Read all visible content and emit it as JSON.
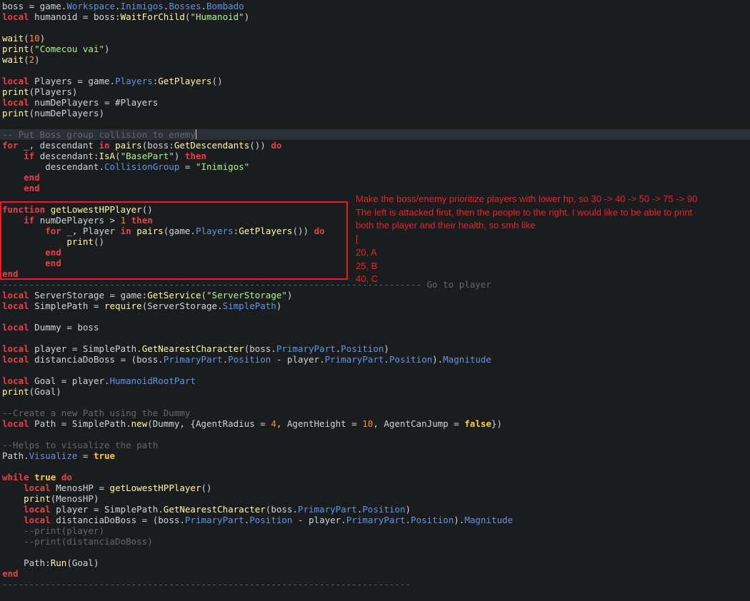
{
  "colors": {
    "background": "#1b1c1e",
    "current_line": "#2a2f38",
    "keyword": "#e6414b",
    "literal": "#fecc3d",
    "function": "#fdfaa6",
    "property": "#6195e6",
    "string": "#adf195",
    "number": "#fe8c2d",
    "comment": "#676767",
    "text": "#d4d4d4",
    "annotation": "#e8232e"
  },
  "code": [
    [
      [
        "boss = game.",
        "txt"
      ],
      [
        "Workspace",
        "prop"
      ],
      [
        ".",
        "txt"
      ],
      [
        "Inimigos",
        "prop"
      ],
      [
        ".",
        "txt"
      ],
      [
        "Bosses",
        "prop"
      ],
      [
        ".",
        "txt"
      ],
      [
        "Bombado",
        "prop"
      ]
    ],
    [
      [
        "local",
        "kw"
      ],
      [
        " humanoid = boss:",
        "txt"
      ],
      [
        "WaitForChild",
        "fn"
      ],
      [
        "(",
        "txt"
      ],
      [
        "\"Humanoid\"",
        "str"
      ],
      [
        ")",
        "txt"
      ]
    ],
    [],
    [
      [
        "wait",
        "fn"
      ],
      [
        "(",
        "txt"
      ],
      [
        "10",
        "num"
      ],
      [
        ")",
        "txt"
      ]
    ],
    [
      [
        "print",
        "fn"
      ],
      [
        "(",
        "txt"
      ],
      [
        "\"Comecou vai\"",
        "str"
      ],
      [
        ")",
        "txt"
      ]
    ],
    [
      [
        "wait",
        "fn"
      ],
      [
        "(",
        "txt"
      ],
      [
        "2",
        "num"
      ],
      [
        ")",
        "txt"
      ]
    ],
    [],
    [
      [
        "local",
        "kw"
      ],
      [
        " Players = game.",
        "txt"
      ],
      [
        "Players",
        "prop"
      ],
      [
        ":",
        "txt"
      ],
      [
        "GetPlayers",
        "fn"
      ],
      [
        "()",
        "txt"
      ]
    ],
    [
      [
        "print",
        "fn"
      ],
      [
        "(Players)",
        "txt"
      ]
    ],
    [
      [
        "local",
        "kw"
      ],
      [
        " numDePlayers = #Players",
        "txt"
      ]
    ],
    [
      [
        "print",
        "fn"
      ],
      [
        "(numDePlayers)",
        "txt"
      ]
    ],
    [],
    [
      [
        "-- Put Boss group collision to enemy",
        "com"
      ]
    ],
    [
      [
        "for",
        "kw"
      ],
      [
        " _, descendant ",
        "txt"
      ],
      [
        "in",
        "kw"
      ],
      [
        " ",
        "txt"
      ],
      [
        "pairs",
        "fn"
      ],
      [
        "(boss:",
        "txt"
      ],
      [
        "GetDescendants",
        "fn"
      ],
      [
        "()) ",
        "txt"
      ],
      [
        "do",
        "kw"
      ]
    ],
    [
      [
        "    ",
        "txt"
      ],
      [
        "if",
        "kw"
      ],
      [
        " descendant:",
        "txt"
      ],
      [
        "IsA",
        "fn"
      ],
      [
        "(",
        "txt"
      ],
      [
        "\"BasePart\"",
        "str"
      ],
      [
        ") ",
        "txt"
      ],
      [
        "then",
        "kw"
      ]
    ],
    [
      [
        "        descendant.",
        "txt"
      ],
      [
        "CollisionGroup",
        "prop"
      ],
      [
        " = ",
        "txt"
      ],
      [
        "\"Inimigos\"",
        "str"
      ]
    ],
    [
      [
        "    ",
        "txt"
      ],
      [
        "end",
        "kw"
      ]
    ],
    [
      [
        "    ",
        "txt"
      ],
      [
        "end",
        "kw"
      ]
    ],
    [],
    [
      [
        "function",
        "kw"
      ],
      [
        " ",
        "txt"
      ],
      [
        "getLowestHPPlayer",
        "fn"
      ],
      [
        "()",
        "txt"
      ]
    ],
    [
      [
        "    ",
        "txt"
      ],
      [
        "if",
        "kw"
      ],
      [
        " numDePlayers > ",
        "txt"
      ],
      [
        "1",
        "num"
      ],
      [
        " ",
        "txt"
      ],
      [
        "then",
        "kw"
      ]
    ],
    [
      [
        "        ",
        "txt"
      ],
      [
        "for",
        "kw"
      ],
      [
        " _, Player ",
        "txt"
      ],
      [
        "in",
        "kw"
      ],
      [
        " ",
        "txt"
      ],
      [
        "pairs",
        "fn"
      ],
      [
        "(game.",
        "txt"
      ],
      [
        "Players",
        "prop"
      ],
      [
        ":",
        "txt"
      ],
      [
        "GetPlayers",
        "fn"
      ],
      [
        "()) ",
        "txt"
      ],
      [
        "do",
        "kw"
      ]
    ],
    [
      [
        "            ",
        "txt"
      ],
      [
        "print",
        "fn"
      ],
      [
        "()",
        "txt"
      ]
    ],
    [
      [
        "        ",
        "txt"
      ],
      [
        "end",
        "kw"
      ]
    ],
    [
      [
        "        ",
        "txt"
      ],
      [
        "end",
        "kw"
      ]
    ],
    [
      [
        "end",
        "kw"
      ]
    ],
    [
      [
        "------------------------------------------------------------------------------ Go to player",
        "com"
      ]
    ],
    [
      [
        "local",
        "kw"
      ],
      [
        " ServerStorage = game:",
        "txt"
      ],
      [
        "GetService",
        "fn"
      ],
      [
        "(",
        "txt"
      ],
      [
        "\"ServerStorage\"",
        "str"
      ],
      [
        ")",
        "txt"
      ]
    ],
    [
      [
        "local",
        "kw"
      ],
      [
        " SimplePath = ",
        "txt"
      ],
      [
        "require",
        "fn"
      ],
      [
        "(ServerStorage.",
        "txt"
      ],
      [
        "SimplePath",
        "prop"
      ],
      [
        ")",
        "txt"
      ]
    ],
    [],
    [
      [
        "local",
        "kw"
      ],
      [
        " Dummy = boss",
        "txt"
      ]
    ],
    [],
    [
      [
        "local",
        "kw"
      ],
      [
        " player = SimplePath.",
        "txt"
      ],
      [
        "GetNearestCharacter",
        "fn"
      ],
      [
        "(boss.",
        "txt"
      ],
      [
        "PrimaryPart",
        "prop"
      ],
      [
        ".",
        "txt"
      ],
      [
        "Position",
        "prop"
      ],
      [
        ")",
        "txt"
      ]
    ],
    [
      [
        "local",
        "kw"
      ],
      [
        " distanciaDoBoss = (boss.",
        "txt"
      ],
      [
        "PrimaryPart",
        "prop"
      ],
      [
        ".",
        "txt"
      ],
      [
        "Position",
        "prop"
      ],
      [
        " - player.",
        "txt"
      ],
      [
        "PrimaryPart",
        "prop"
      ],
      [
        ".",
        "txt"
      ],
      [
        "Position",
        "prop"
      ],
      [
        ").",
        "txt"
      ],
      [
        "Magnitude",
        "prop"
      ]
    ],
    [],
    [
      [
        "local",
        "kw"
      ],
      [
        " Goal = player.",
        "txt"
      ],
      [
        "HumanoidRootPart",
        "prop"
      ]
    ],
    [
      [
        "print",
        "fn"
      ],
      [
        "(Goal)",
        "txt"
      ]
    ],
    [],
    [
      [
        "--Create a new Path using the Dummy",
        "com"
      ]
    ],
    [
      [
        "local",
        "kw"
      ],
      [
        " Path = SimplePath.",
        "txt"
      ],
      [
        "new",
        "fn"
      ],
      [
        "(Dummy, {AgentRadius = ",
        "txt"
      ],
      [
        "4",
        "num"
      ],
      [
        ", AgentHeight = ",
        "txt"
      ],
      [
        "10",
        "num"
      ],
      [
        ", AgentCanJump = ",
        "txt"
      ],
      [
        "false",
        "lit"
      ],
      [
        "})",
        "txt"
      ]
    ],
    [],
    [
      [
        "--Helps to visualize the path",
        "com"
      ]
    ],
    [
      [
        "Path.",
        "txt"
      ],
      [
        "Visualize",
        "prop"
      ],
      [
        " = ",
        "txt"
      ],
      [
        "true",
        "lit"
      ]
    ],
    [],
    [
      [
        "while",
        "kw"
      ],
      [
        " ",
        "txt"
      ],
      [
        "true",
        "lit"
      ],
      [
        " ",
        "txt"
      ],
      [
        "do",
        "kw"
      ]
    ],
    [
      [
        "    ",
        "txt"
      ],
      [
        "local",
        "kw"
      ],
      [
        " MenosHP = ",
        "txt"
      ],
      [
        "getLowestHPPlayer",
        "fn"
      ],
      [
        "()",
        "txt"
      ]
    ],
    [
      [
        "    ",
        "txt"
      ],
      [
        "print",
        "fn"
      ],
      [
        "(MenosHP)",
        "txt"
      ]
    ],
    [
      [
        "    ",
        "txt"
      ],
      [
        "local",
        "kw"
      ],
      [
        " player = SimplePath.",
        "txt"
      ],
      [
        "GetNearestCharacter",
        "fn"
      ],
      [
        "(boss.",
        "txt"
      ],
      [
        "PrimaryPart",
        "prop"
      ],
      [
        ".",
        "txt"
      ],
      [
        "Position",
        "prop"
      ],
      [
        ")",
        "txt"
      ]
    ],
    [
      [
        "    ",
        "txt"
      ],
      [
        "local",
        "kw"
      ],
      [
        " distanciaDoBoss = (boss.",
        "txt"
      ],
      [
        "PrimaryPart",
        "prop"
      ],
      [
        ".",
        "txt"
      ],
      [
        "Position",
        "prop"
      ],
      [
        " - player.",
        "txt"
      ],
      [
        "PrimaryPart",
        "prop"
      ],
      [
        ".",
        "txt"
      ],
      [
        "Position",
        "prop"
      ],
      [
        ").",
        "txt"
      ],
      [
        "Magnitude",
        "prop"
      ]
    ],
    [
      [
        "    --print(player)",
        "com"
      ]
    ],
    [
      [
        "    --print(distanciaDoBoss)",
        "com"
      ]
    ],
    [],
    [
      [
        "    Path:",
        "txt"
      ],
      [
        "Run",
        "fn"
      ],
      [
        "(Goal)",
        "txt"
      ]
    ],
    [
      [
        "end",
        "kw"
      ]
    ],
    [
      [
        "----------------------------------------------------------------------------",
        "com"
      ]
    ]
  ],
  "current_line_index": 12,
  "annotation": {
    "lines": [
      "Make the boss/enemy prioritize players with lower hp, so 30 -> 40 -> 50 -> 75 -> 90",
      "The left is attacked first, then the people to the right. I would like to be able to print",
      "both the player and their health, so smh like",
      "[",
      "20, A",
      "25, B",
      "40, C"
    ]
  }
}
